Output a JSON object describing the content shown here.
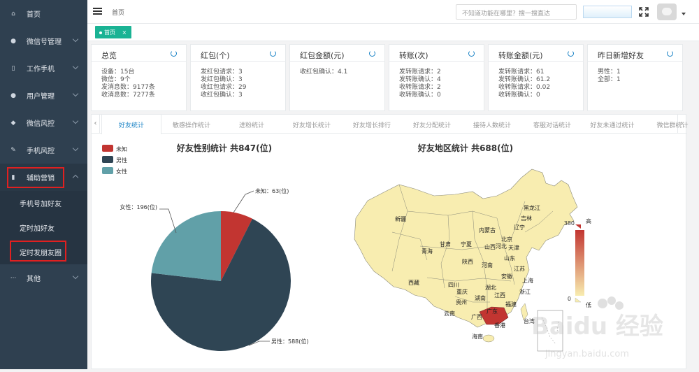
{
  "sidebar": {
    "items": [
      {
        "label": "首页",
        "icon": "home-icon",
        "glyph": "⌂"
      },
      {
        "label": "微信号管理",
        "icon": "wechat-icon",
        "glyph": "●"
      },
      {
        "label": "工作手机",
        "icon": "phone-icon",
        "glyph": "▯"
      },
      {
        "label": "用户管理",
        "icon": "user-icon",
        "glyph": "●"
      },
      {
        "label": "微信风控",
        "icon": "shield-icon",
        "glyph": "◆"
      },
      {
        "label": "手机风控",
        "icon": "mobile-risk-icon",
        "glyph": "✎"
      },
      {
        "label": "辅助营销",
        "icon": "chart-icon",
        "glyph": "▮"
      },
      {
        "label": "其他",
        "icon": "more-icon",
        "glyph": "···"
      }
    ],
    "sub_items": [
      "手机号加好友",
      "定时加好友",
      "定时发朋友圈"
    ]
  },
  "topbar": {
    "breadcrumb": "首页",
    "search_placeholder": "不知道功能在哪里？搜一搜直达"
  },
  "open_tab": {
    "label": "首页",
    "close": "×"
  },
  "cards": [
    {
      "title": "总览",
      "lines": [
        "设备：15台",
        "微信：9个",
        "发消息数：9177条",
        "收消息数：7277条"
      ]
    },
    {
      "title": "红包(个)",
      "lines": [
        "发红包请求：3",
        "发红包确认：3",
        "收红包请求：29",
        "收红包确认：3"
      ]
    },
    {
      "title": "红包金额(元)",
      "lines": [
        "收红包确认：4.1"
      ]
    },
    {
      "title": "转账(次)",
      "lines": [
        "发转账请求：2",
        "发转账确认：4",
        "收转账请求：2",
        "收转账确认：0"
      ]
    },
    {
      "title": "转账金额(元)",
      "lines": [
        "发转账请求：61",
        "发转账确认：61.2",
        "收转账请求：0.02",
        "收转账确认：0"
      ]
    },
    {
      "title": "昨日新增好友",
      "lines": [
        "男性：1",
        "全部：1"
      ]
    }
  ],
  "stat_tabs": [
    "好友统计",
    "敏感操作统计",
    "进粉统计",
    "好友增长统计",
    "好友增长排行",
    "好友分配统计",
    "接待人数统计",
    "客服对话统计",
    "好友未通过统计",
    "微信群统计"
  ],
  "colors": {
    "sidebar_bg": "#2f4050",
    "accent_green": "#1ab394",
    "accent_blue": "#1c84c6",
    "pie_unknown": "#c23531",
    "pie_male": "#2f4554",
    "pie_female": "#61a0a8",
    "map_low": "#f8edb0",
    "map_high": "#c23531"
  },
  "chart_data": [
    {
      "type": "pie",
      "title": "好友性别统计 共847(位)",
      "legend": [
        "未知",
        "男性",
        "女性"
      ],
      "legend_position": "top-left",
      "slices": [
        {
          "name": "未知",
          "value": 63,
          "label": "未知：63(位)"
        },
        {
          "name": "男性",
          "value": 588,
          "label": "男性：588(位)"
        },
        {
          "name": "女性",
          "value": 196,
          "label": "女性：196(位)"
        }
      ]
    },
    {
      "type": "heatmap",
      "title": "好友地区统计 共688(位)",
      "visual_map": {
        "max": 380,
        "min": 0,
        "high_label": "高",
        "low_label": "低"
      },
      "highlighted_region": "广东",
      "region_labels": [
        "新疆",
        "西藏",
        "青海",
        "甘肃",
        "内蒙古",
        "黑龙江",
        "吉林",
        "辽宁",
        "北京",
        "天津",
        "河北",
        "山西",
        "山东",
        "宁夏",
        "陕西",
        "河南",
        "江苏",
        "安徽",
        "上海",
        "四川",
        "重庆",
        "湖北",
        "浙江",
        "贵州",
        "湖南",
        "江西",
        "云南",
        "福建",
        "广西",
        "广东",
        "台湾",
        "香港",
        "海南"
      ]
    }
  ],
  "watermark": {
    "brand": "Baidu 经验",
    "url": "jingyan.baidu.com"
  }
}
